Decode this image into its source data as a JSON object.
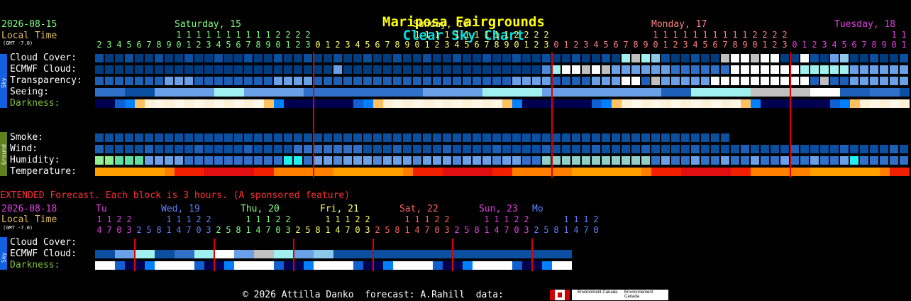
{
  "title": {
    "site": "Mariposa Fairgrounds",
    "chart": "Clear Sky Chart"
  },
  "header": {
    "date": "2026-08-15",
    "local_time_label": "Local Time",
    "gmt_label": "(GMT -7.0)",
    "days": [
      {
        "label": "Saturday, 15",
        "color": "#80ff80"
      },
      {
        "label": "Sunday, 16",
        "color": "#ffff60"
      },
      {
        "label": "Monday, 17",
        "color": "#ff8080"
      },
      {
        "label": "Tuesday, 18",
        "color": "#e040e0"
      }
    ],
    "hours": [
      "2",
      "3",
      "4",
      "5",
      "6",
      "7",
      "8",
      "9",
      "10",
      "11",
      "12",
      "13",
      "14",
      "15",
      "16",
      "17",
      "18",
      "19",
      "20",
      "21",
      "22",
      "23",
      "0",
      "1",
      "2",
      "3",
      "4",
      "5",
      "6",
      "7",
      "8",
      "9",
      "10",
      "11",
      "12",
      "13",
      "14",
      "15",
      "16",
      "17",
      "18",
      "19",
      "20",
      "21",
      "22",
      "23",
      "0",
      "1",
      "2",
      "3",
      "4",
      "5",
      "6",
      "7",
      "8",
      "9",
      "10",
      "11",
      "12",
      "13",
      "14",
      "15",
      "16",
      "17",
      "18",
      "19",
      "20",
      "21",
      "22",
      "23",
      "0",
      "1",
      "2",
      "3",
      "4",
      "5",
      "6",
      "7",
      "8",
      "9",
      "10",
      "11"
    ]
  },
  "sky_tab": "Sky",
  "ground_tab": "Ground",
  "rows": {
    "cloud": "Cloud Cover:",
    "ecmwf": "ECMWF Cloud:",
    "transparency": "Transparency:",
    "seeing": "Seeing:",
    "darkness": "Darkness:",
    "smoke": "Smoke:",
    "wind": "Wind:",
    "humidity": "Humidity:",
    "temperature": "Temperature:"
  },
  "extended": {
    "note": "EXTENDED Forecast. Each block is 3 hours. (A sponsored feature)",
    "date": "2026-08-18",
    "local_time_label": "Local Time",
    "gmt_label": "(GMT -7.0)",
    "days": [
      {
        "label": "Tu",
        "color": "#e040e0"
      },
      {
        "label": "Wed, 19",
        "color": "#6080ff"
      },
      {
        "label": "Thu, 20",
        "color": "#80ff80"
      },
      {
        "label": "Fri, 21",
        "color": "#ffff60"
      },
      {
        "label": "Sat, 22",
        "color": "#ff6060"
      },
      {
        "label": "Sun, 23",
        "color": "#e040e0"
      },
      {
        "label": "Mo",
        "color": "#6080ff"
      }
    ],
    "hours": [
      "14",
      "17",
      "20",
      "23",
      "2",
      "5",
      "8",
      "11",
      "14",
      "17",
      "20",
      "23",
      "2",
      "5",
      "8",
      "11",
      "14",
      "17",
      "20",
      "23",
      "2",
      "5",
      "8",
      "11",
      "14",
      "17",
      "20",
      "23",
      "2",
      "5",
      "8",
      "11",
      "14",
      "17",
      "20",
      "23",
      "2",
      "5",
      "8",
      "11",
      "14",
      "17",
      "20",
      "23",
      "2",
      "5",
      "8",
      "11",
      "14",
      "17",
      "20"
    ],
    "rows": {
      "cloud": "Cloud Cover:",
      "ecmwf": "ECMWF Cloud:",
      "darkness": "Darkness:"
    }
  },
  "footer": {
    "text": "© 2026 Attilla Danko  forecast: A.Rahill  data:",
    "logo1": "Environment Canada",
    "logo2": "Environnement Canada"
  },
  "chart_data": {
    "type": "heatmap",
    "title": "Mariposa Fairgrounds Clear Sky Chart",
    "x_hours_start": "2026-08-15 02:00",
    "rows": [
      "Cloud Cover",
      "ECMWF Cloud",
      "Transparency",
      "Seeing",
      "Darkness",
      "Smoke",
      "Wind",
      "Humidity",
      "Temperature"
    ]
  },
  "colors": {
    "title_site": "#ffff00",
    "title_chart": "#00e0e0",
    "accent_green": "#80ff80",
    "accent_yellow": "#e0c060",
    "midnight_line": "#e00000",
    "extended_note": "#ff3030"
  }
}
